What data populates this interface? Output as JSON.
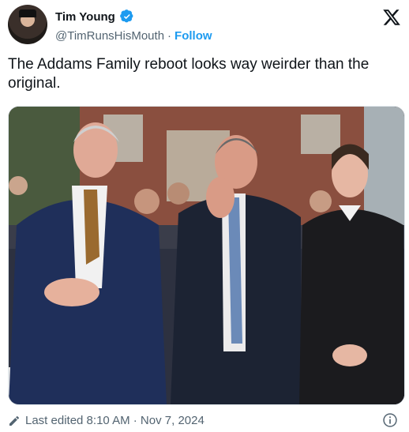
{
  "author": {
    "name": "Tim Young",
    "handle": "@TimRunsHisMouth",
    "separator": "·",
    "follow_label": "Follow"
  },
  "tweet": {
    "text": "The Addams Family reboot looks way weirder than the original."
  },
  "footer": {
    "edited_label": "Last edited 8:10 AM · Nov 7, 2024"
  },
  "colors": {
    "link": "#1d9bf0",
    "secondary_text": "#536471",
    "primary_text": "#0f1419"
  },
  "icons": {
    "verified": "verified-badge-icon",
    "x_logo": "x-logo-icon",
    "pencil": "pencil-icon",
    "info": "info-icon"
  }
}
